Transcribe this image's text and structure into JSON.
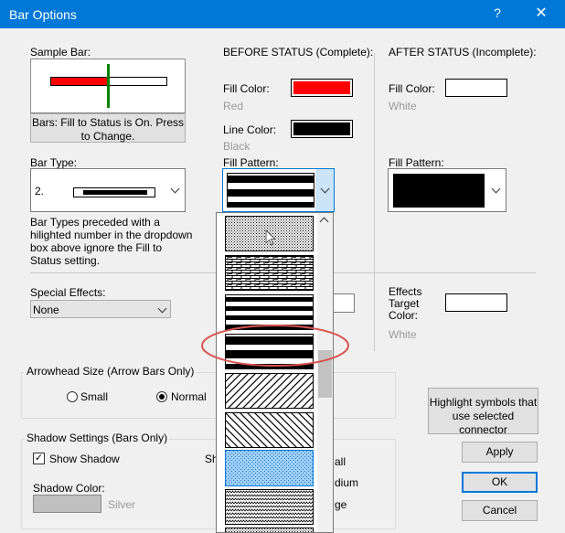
{
  "window": {
    "title": "Bar Options",
    "help_glyph": "?",
    "close_glyph": "✕"
  },
  "sample": {
    "label": "Sample Bar:",
    "button_label": "Bars: Fill to Status is On. Press to Change."
  },
  "before": {
    "header": "BEFORE STATUS (Complete):",
    "fill_color_label": "Fill Color:",
    "fill_color_value": "Red",
    "fill_color_hex": "#ff0000",
    "line_color_label": "Line Color:",
    "line_color_value": "Black",
    "line_color_hex": "#000000",
    "fill_pattern_label": "Fill Pattern:"
  },
  "after": {
    "header": "AFTER STATUS (Incomplete):",
    "fill_color_label": "Fill Color:",
    "fill_color_value": "White",
    "fill_color_hex": "#ffffff",
    "fill_pattern_label": "Fill Pattern:"
  },
  "bar_type": {
    "label": "Bar Type:",
    "number": "2.",
    "note": "Bar Types preceded with a hilighted number in the dropdown box above ignore the Fill to Status setting."
  },
  "special_effects": {
    "label": "Special Effects:",
    "value": "None"
  },
  "effects_target": {
    "label": "Effects Target Color:",
    "value": "White"
  },
  "arrowhead": {
    "group_label": "Arrowhead Size (Arrow Bars Only)",
    "options": [
      {
        "label": "Small",
        "selected": false
      },
      {
        "label": "Normal",
        "selected": true
      }
    ]
  },
  "shadow": {
    "group_label": "Shadow Settings (Bars Only)",
    "show_shadow_label": "Show Shadow",
    "show_shadow_checked": true,
    "shadow_color_label": "Shadow Color:",
    "shadow_color_value": "Silver",
    "shadow_color_hex": "#c0c0c0",
    "shadow_size_partial": "Sha",
    "size_partials": [
      "all",
      "dium",
      "ge"
    ]
  },
  "buttons": {
    "highlight": "Highlight symbols that use selected connector",
    "apply": "Apply",
    "ok": "OK",
    "cancel": "Cancel"
  },
  "icons": {
    "dropdown": "chevron-down-icon",
    "scroll_up": "scroll-up-arrow-icon",
    "cursor": "mouse-pointer-icon",
    "annotation": "red-highlight-ellipse",
    "check": "check-icon"
  },
  "colors": {
    "title_bar": "#0078d7",
    "dialog_bg": "#f0f0f0",
    "sample_green": "#008000",
    "annotation_red": "#d9534f",
    "hatch_blue": "#3c8fd6"
  }
}
